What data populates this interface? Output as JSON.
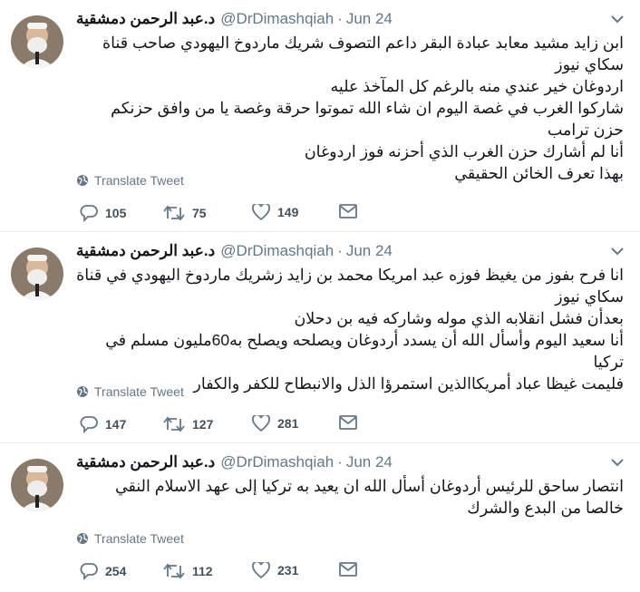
{
  "tweets": [
    {
      "name": "د.عبد الرحمن دمشقية",
      "handle": "@DrDimashqiah",
      "dot": "·",
      "date": "Jun 24",
      "text": "ابن زايد مشيد معابد عبادة البقر داعم التصوف شريك ماردوخ اليهودي صاحب قناة سكاي نيوز\nاردوغان خير عندي منه بالرغم كل المآخذ عليه\nشاركوا الغرب في غصة اليوم ان شاء الله تموتوا حرقة وغصة يا من وافق حزنكم حزن ترامب\nأنا لم أشارك حزن الغرب الذي أحزنه فوز اردوغان\nبهذا تعرف الخائن الحقيقي",
      "translate": "Translate Tweet",
      "replies": "105",
      "retweets": "75",
      "likes": "149"
    },
    {
      "name": "د.عبد الرحمن دمشقية",
      "handle": "@DrDimashqiah",
      "dot": "·",
      "date": "Jun 24",
      "text": "انا فرح بفوز من يغيظ فوزه عبد امريكا محمد بن زايد زشريك ماردوخ اليهودي في قناة سكاي نيوز\nبعدأن فشل انقلابه الذي موله وشاركه فيه بن دحلان\nأنا سعيد اليوم وأسأل الله أن يسدد أردوغان ويصلحه ويصلح به60مليون مسلم في تركيا\nفليمت غيظا عباد أمريكاالذين استمرؤا الذل والانبطاح للكفر والكفار",
      "translate": "Translate Tweet",
      "replies": "147",
      "retweets": "127",
      "likes": "281"
    },
    {
      "name": "د.عبد الرحمن دمشقية",
      "handle": "@DrDimashqiah",
      "dot": "·",
      "date": "Jun 24",
      "text": "انتصار ساحق للرئيس أردوغان أسأل الله ان يعيد به تركيا إلى عهد الاسلام النقي خالصا من البدع والشرك",
      "translate": "Translate Tweet",
      "replies": "254",
      "retweets": "112",
      "likes": "231"
    }
  ],
  "colors": {
    "text": "#14171a",
    "muted": "#657786",
    "border": "#e6ecf0"
  },
  "icons": [
    "chevron-down-icon",
    "globe-icon",
    "reply-icon",
    "retweet-icon",
    "like-icon",
    "message-icon"
  ]
}
